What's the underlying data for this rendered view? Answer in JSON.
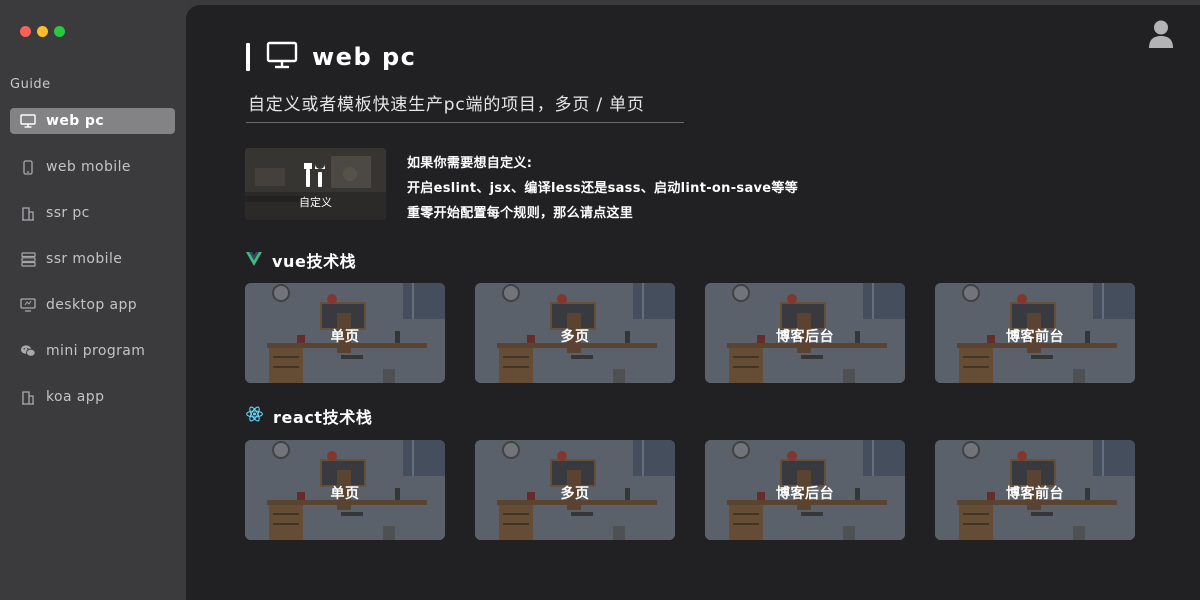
{
  "window": {
    "traffic_colors": [
      "#fe5f57",
      "#febc2e",
      "#28c840"
    ]
  },
  "sidebar": {
    "section_label": "Guide",
    "items": [
      {
        "label": "web pc",
        "icon": "monitor-icon",
        "active": true
      },
      {
        "label": "web mobile",
        "icon": "mobile-icon",
        "active": false
      },
      {
        "label": "ssr pc",
        "icon": "building-icon",
        "active": false
      },
      {
        "label": "ssr mobile",
        "icon": "server-icon",
        "active": false
      },
      {
        "label": "desktop app",
        "icon": "desktop-icon",
        "active": false
      },
      {
        "label": "mini program",
        "icon": "wechat-icon",
        "active": false
      },
      {
        "label": "koa app",
        "icon": "building-icon",
        "active": false
      }
    ]
  },
  "header": {
    "avatar_icon": "user-icon"
  },
  "main": {
    "title": "web pc",
    "subtitle": "自定义或者模板快速生产pc端的项目，多页 / 单页",
    "custom": {
      "card_label": "自定义",
      "lines": [
        "如果你需要想自定义:",
        "开启eslint、jsx、编译less还是sass、启动lint-on-save等等",
        "重零开始配置每个规则，那么请点这里"
      ]
    },
    "stacks": [
      {
        "title": "vue技术栈",
        "icon": "vue-icon",
        "templates": [
          "单页",
          "多页",
          "博客后台",
          "博客前台"
        ]
      },
      {
        "title": "react技术栈",
        "icon": "react-icon",
        "templates": [
          "单页",
          "多页",
          "博客后台",
          "博客前台"
        ]
      }
    ]
  },
  "colors": {
    "accent_vue": "#41b883",
    "accent_react": "#61dafb",
    "sidebar_active": "#838386"
  }
}
